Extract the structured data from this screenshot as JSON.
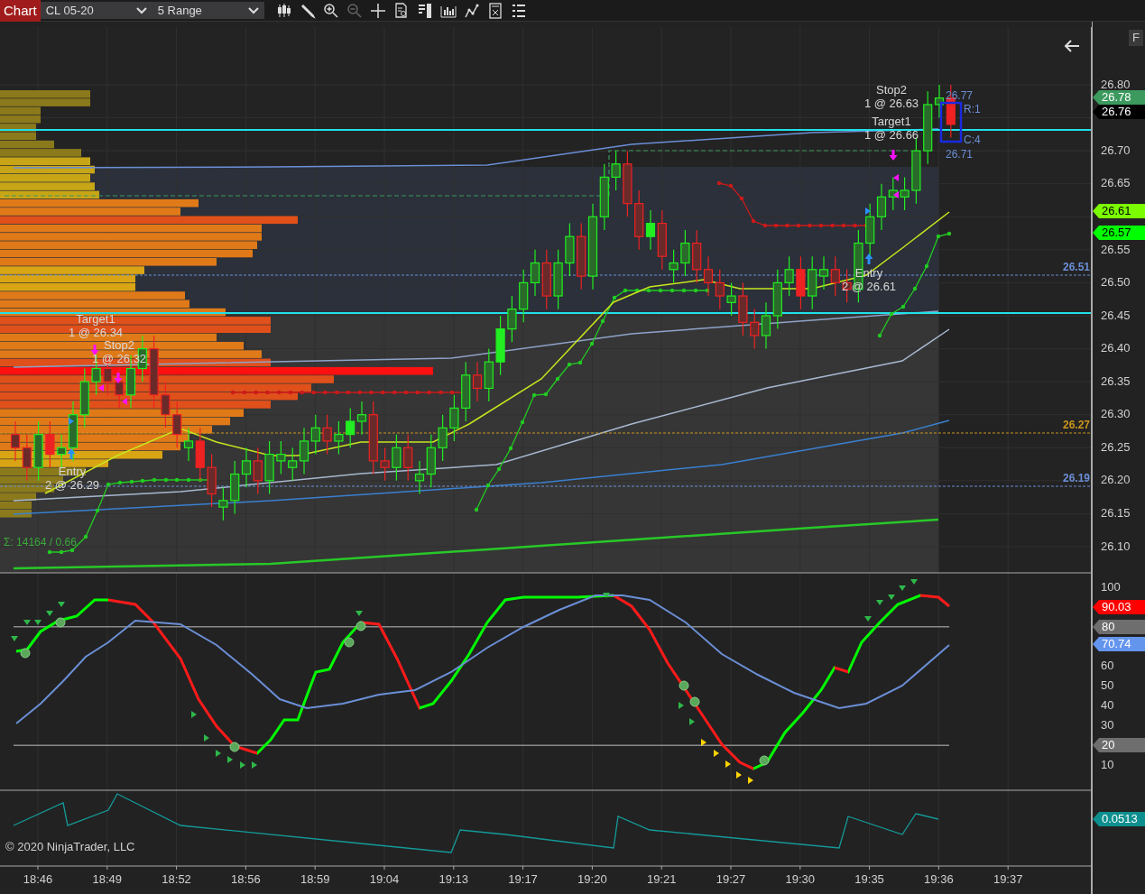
{
  "toolbar": {
    "title": "Chart",
    "instrument": "CL 05-20",
    "bar_type": "5 Range",
    "tools": [
      {
        "kind": "candles",
        "disabled": false
      },
      {
        "kind": "pencil",
        "disabled": false
      },
      {
        "kind": "zoom_in",
        "disabled": false
      },
      {
        "kind": "zoom_out",
        "disabled": true
      },
      {
        "kind": "crosshair",
        "disabled": false
      },
      {
        "kind": "data_box",
        "disabled": false
      },
      {
        "kind": "panels",
        "disabled": false
      },
      {
        "kind": "bars",
        "disabled": false
      },
      {
        "kind": "line",
        "disabled": false
      },
      {
        "kind": "properties",
        "disabled": false
      },
      {
        "kind": "list",
        "disabled": false
      }
    ]
  },
  "side_button": "F",
  "price_panel": {
    "order_labels": [
      {
        "title": "Stop2",
        "detail": "1 @ 26.63"
      },
      {
        "title": "Target1",
        "detail": "1 @ 26.66"
      },
      {
        "title": "Entry",
        "detail": "2 @ 26.61"
      },
      {
        "title": "Target1",
        "detail": "1 @ 26.34"
      },
      {
        "title": "Stop2",
        "detail": "1 @ 26.32"
      },
      {
        "title": "Entry",
        "detail": "2 @ 26.29"
      }
    ],
    "bar_info": {
      "high": "26.77",
      "range": "R:1",
      "count": "C:4",
      "low": "26.71"
    },
    "summary": "Σ: 14164 / 0.66",
    "level_lines": [
      {
        "label": "26.51",
        "color": "#6b8fd6"
      },
      {
        "label": "26.27",
        "color": "#c8961e"
      },
      {
        "label": "26.19",
        "color": "#6b8fd6"
      }
    ],
    "axis_ticks": [
      "26.80",
      "26.70",
      "26.65",
      "26.55",
      "26.50",
      "26.45",
      "26.40",
      "26.35",
      "26.30",
      "26.25",
      "26.20",
      "26.15",
      "26.10"
    ],
    "price_markers": [
      {
        "label": "26.78",
        "color": "#3c9a5f"
      },
      {
        "label": "26.76",
        "color": "#000000"
      },
      {
        "label": "26.61",
        "color": "#7cfc00"
      },
      {
        "label": "26.57",
        "color": "#00ff00"
      }
    ]
  },
  "oscillator_panel": {
    "axis_ticks": [
      "100",
      "60",
      "50",
      "40",
      "30",
      "10"
    ],
    "markers": [
      {
        "label": "90.03",
        "color": "#ff0000"
      },
      {
        "label": "80",
        "color": "#6e6e6e"
      },
      {
        "label": "70.74",
        "color": "#6495ed"
      },
      {
        "label": "20",
        "color": "#6e6e6e"
      }
    ]
  },
  "lower_panel": {
    "markers": [
      {
        "label": "0.0513",
        "color": "#0e8f8f"
      }
    ]
  },
  "copyright": "© 2020 NinjaTrader, LLC",
  "time_axis": [
    "18:46",
    "18:49",
    "18:52",
    "18:56",
    "18:59",
    "19:04",
    "19:13",
    "19:17",
    "19:20",
    "19:21",
    "19:27",
    "19:30",
    "19:35",
    "19:36",
    "19:37"
  ]
}
